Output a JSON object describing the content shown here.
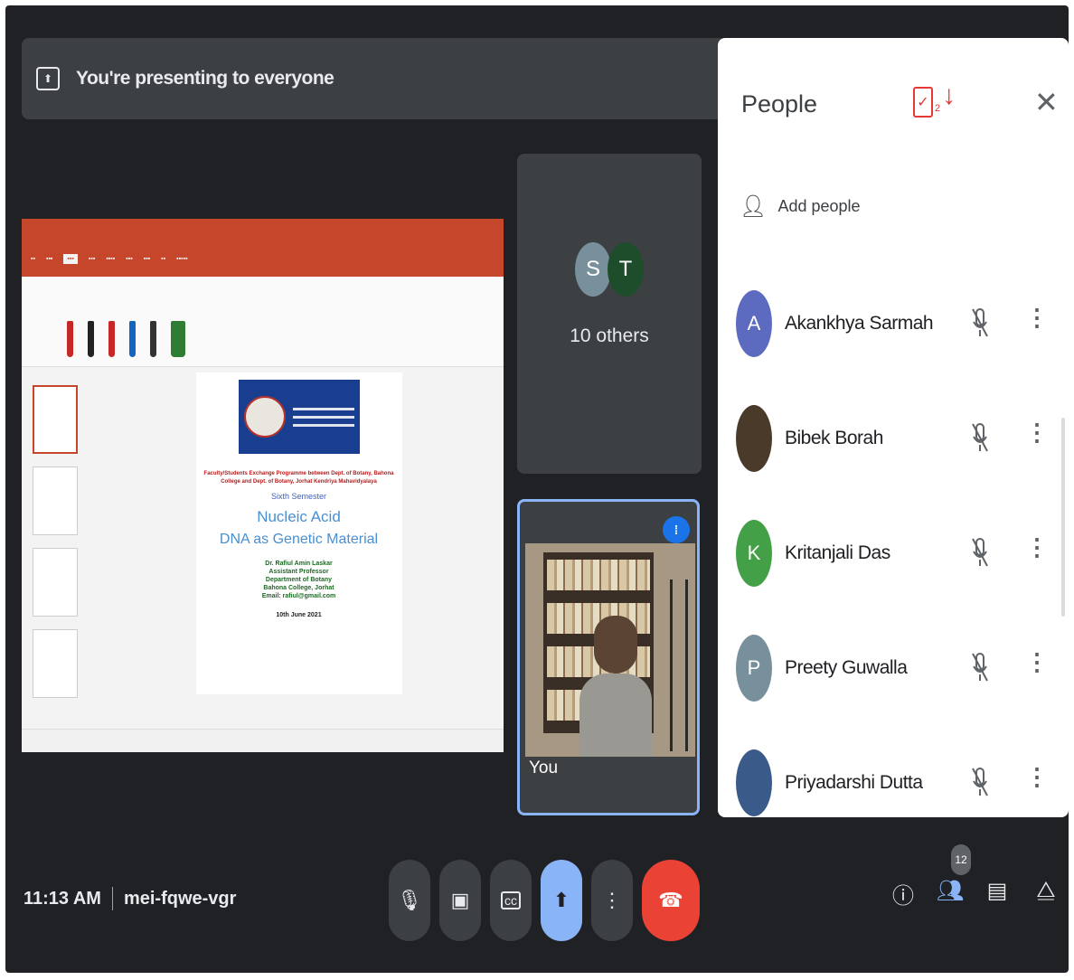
{
  "banner": {
    "icon": "present-screen-icon",
    "text": "You're presenting to everyone"
  },
  "tiles": {
    "others": {
      "avatars": [
        "S",
        "T"
      ],
      "label": "10 others"
    },
    "self": {
      "label": "You"
    }
  },
  "people_panel": {
    "title": "People",
    "mark_number": "2",
    "close_icon": "close-icon",
    "add_people_label": "Add people",
    "participants": [
      {
        "name": "Akankhya Sarmah",
        "initial": "A",
        "color": "#5c6bc0"
      },
      {
        "name": "Bibek Borah",
        "initial": "",
        "color": "#4a3a2a"
      },
      {
        "name": "Kritanjali Das",
        "initial": "K",
        "color": "#43a047"
      },
      {
        "name": "Preety Guwalla",
        "initial": "P",
        "color": "#78909c"
      },
      {
        "name": "Priyadarshi Dutta",
        "initial": "",
        "color": "#3a5a8a"
      }
    ]
  },
  "slide": {
    "red_text": "Faculty/Students Exchange Programme between Dept. of Botany, Bahona College and Dept. of Botany, Jorhat Kendriya Mahavidyalaya",
    "semester": "Sixth Semester",
    "heading1": "Nucleic Acid",
    "heading2": "DNA as Genetic Material",
    "author": [
      "Dr. Rafiul Amin Laskar",
      "Assistant Professor",
      "Department of Botany",
      "Bahona College, Jorhat",
      "Email: rafiul@gmail.com"
    ],
    "date": "10th June 2021"
  },
  "bottom_bar": {
    "time": "11:13 AM",
    "meeting_code": "mei-fqwe-vgr",
    "people_count": "12"
  },
  "colors": {
    "accent": "#8ab4f8",
    "hangup": "#ea4335",
    "background": "#202124"
  }
}
